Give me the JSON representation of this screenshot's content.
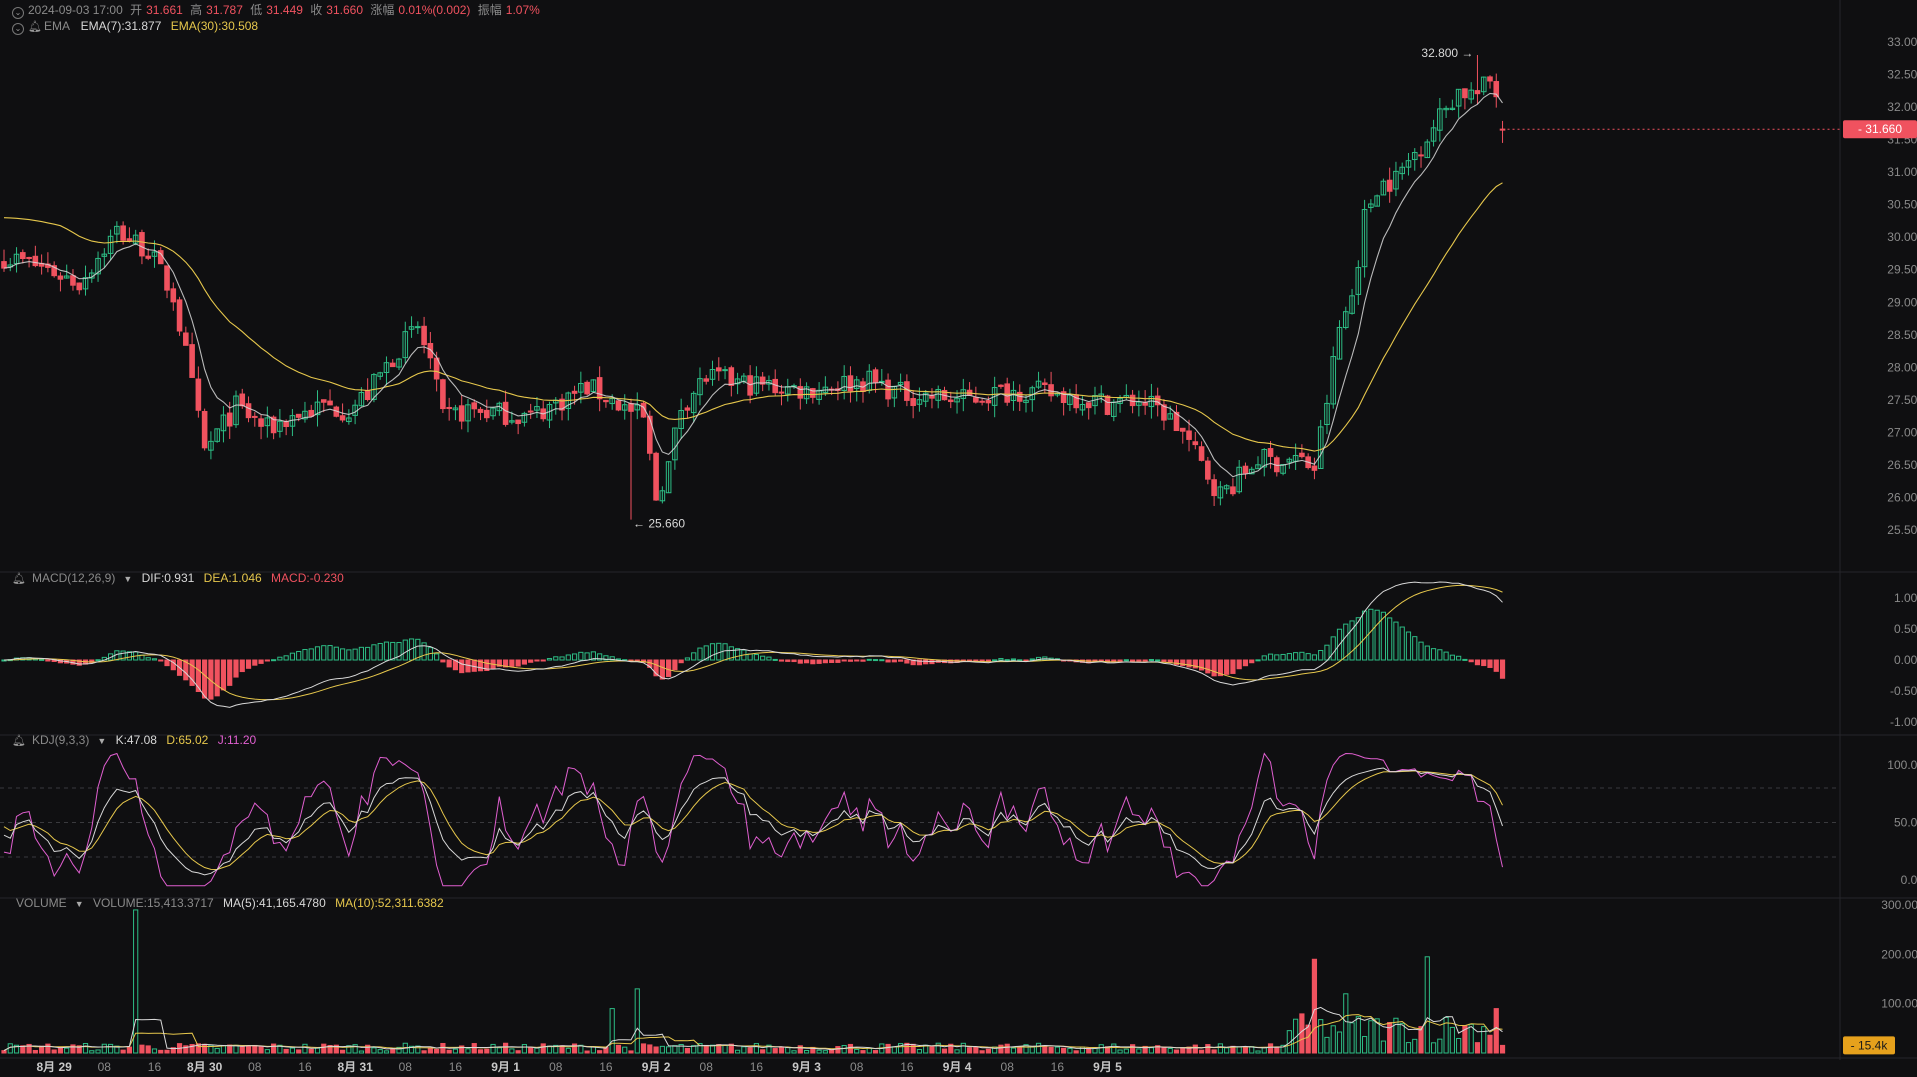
{
  "header": {
    "datetime": "2024-09-03 17:00",
    "open_label": "开",
    "open": "31.661",
    "high_label": "高",
    "high": "31.787",
    "low_label": "低",
    "low": "31.449",
    "close_label": "收",
    "close": "31.660",
    "change_label": "涨幅",
    "change": "0.01%(0.002)",
    "amp_label": "振幅",
    "amp": "1.07%"
  },
  "ema": {
    "label": "EMA",
    "ema7": "EMA(7):31.877",
    "ema30": "EMA(30):30.508"
  },
  "macd": {
    "label": "MACD(12,26,9)",
    "dif": "DIF:0.931",
    "dea": "DEA:1.046",
    "macd": "MACD:-0.230"
  },
  "kdj": {
    "label": "KDJ(9,3,3)",
    "k": "K:47.08",
    "d": "D:65.02",
    "j": "J:11.20"
  },
  "volume": {
    "label": "VOLUME",
    "vol": "VOLUME:15,413.3717",
    "ma5": "MA(5):41,165.4780",
    "ma10": "MA(10):52,311.6382"
  },
  "price_axis": [
    "33.000",
    "32.500",
    "32.000",
    "31.500",
    "31.000",
    "30.500",
    "30.000",
    "29.500",
    "29.000",
    "28.500",
    "28.000",
    "27.500",
    "27.000",
    "26.500",
    "26.000",
    "25.500"
  ],
  "macd_axis": [
    "1.000",
    "0.500",
    "0.000",
    "-0.500",
    "-1.000"
  ],
  "kdj_axis": [
    "100.00",
    "50.00",
    "0.00"
  ],
  "vol_axis": [
    "300.00k",
    "200.00k",
    "100.00k"
  ],
  "last_price": "31.660",
  "last_volume": "15.4k",
  "annotations": {
    "max": "32.800",
    "min": "25.660"
  },
  "time_axis": [
    {
      "t": "8月 29",
      "bold": true
    },
    {
      "t": "08"
    },
    {
      "t": "16"
    },
    {
      "t": "8月 30",
      "bold": true
    },
    {
      "t": "08"
    },
    {
      "t": "16"
    },
    {
      "t": "8月 31",
      "bold": true
    },
    {
      "t": "08"
    },
    {
      "t": "16"
    },
    {
      "t": "9月 1",
      "bold": true
    },
    {
      "t": "08"
    },
    {
      "t": "16"
    },
    {
      "t": "9月 2",
      "bold": true
    },
    {
      "t": "08"
    },
    {
      "t": "16"
    },
    {
      "t": "9月 3",
      "bold": true
    },
    {
      "t": "08"
    },
    {
      "t": "16"
    },
    {
      "t": "9月 4",
      "bold": true
    },
    {
      "t": "08"
    },
    {
      "t": "16"
    },
    {
      "t": "9月 5",
      "bold": true
    }
  ],
  "colors": {
    "up": "#2dbd85",
    "down": "#f0525f",
    "ema7": "#d8d8d8",
    "ema30": "#e6c74c",
    "j_line": "#e05fd0",
    "last_vol_tag": "#e6a11c"
  },
  "chart_data": {
    "type": "candlestick",
    "interval": "hourly",
    "start": "2024-08-28 16:00",
    "ylim": [
      25.5,
      33.0
    ],
    "close_path": [
      [
        0,
        29.7
      ],
      [
        6,
        29.55
      ],
      [
        12,
        29.3
      ],
      [
        18,
        30.1
      ],
      [
        23,
        29.8
      ],
      [
        27,
        29.1
      ],
      [
        29,
        28.2
      ],
      [
        32,
        26.7
      ],
      [
        37,
        27.4
      ],
      [
        42,
        27.05
      ],
      [
        46,
        27.25
      ],
      [
        51,
        27.4
      ],
      [
        55,
        27.35
      ],
      [
        58,
        27.6
      ],
      [
        63,
        28.3
      ],
      [
        66,
        28.6
      ],
      [
        68,
        28.1
      ],
      [
        70,
        27.2
      ],
      [
        74,
        27.35
      ],
      [
        79,
        27.3
      ],
      [
        84,
        27.25
      ],
      [
        89,
        27.5
      ],
      [
        93,
        27.7
      ],
      [
        97,
        27.5
      ],
      [
        102,
        27.2
      ],
      [
        104,
        26.0
      ],
      [
        106,
        26.5
      ],
      [
        108,
        27.4
      ],
      [
        112,
        27.85
      ],
      [
        118,
        27.75
      ],
      [
        123,
        27.7
      ],
      [
        128,
        27.65
      ],
      [
        133,
        27.75
      ],
      [
        138,
        27.8
      ],
      [
        143,
        27.6
      ],
      [
        148,
        27.55
      ],
      [
        153,
        27.5
      ],
      [
        158,
        27.6
      ],
      [
        162,
        27.65
      ],
      [
        166,
        27.6
      ],
      [
        171,
        27.55
      ],
      [
        176,
        27.45
      ],
      [
        181,
        27.5
      ],
      [
        185,
        27.3
      ],
      [
        188,
        27.0
      ],
      [
        191,
        26.5
      ],
      [
        194,
        26.05
      ],
      [
        197,
        26.3
      ],
      [
        200,
        26.6
      ],
      [
        203,
        26.55
      ],
      [
        206,
        26.6
      ],
      [
        209,
        26.45
      ],
      [
        211,
        27.5
      ],
      [
        213,
        28.6
      ],
      [
        215,
        29.1
      ],
      [
        217,
        30.3
      ],
      [
        219,
        30.8
      ],
      [
        222,
        30.9
      ],
      [
        225,
        31.3
      ],
      [
        228,
        31.7
      ],
      [
        230,
        32.0
      ],
      [
        232,
        32.25
      ],
      [
        235,
        32.2
      ],
      [
        237,
        32.4
      ],
      [
        239,
        32.1
      ],
      [
        240,
        31.66
      ]
    ],
    "ema7_last": 31.877,
    "ema30_last": 30.508,
    "max": 32.8,
    "min": 25.66,
    "macd": {
      "dif": 0.931,
      "dea": 1.046,
      "hist": -0.23,
      "ylim": [
        -1.0,
        1.0
      ]
    },
    "kdj": {
      "k": 47.08,
      "d": 65.02,
      "j": 11.2,
      "ylim": [
        0,
        100
      ]
    },
    "volume": {
      "last": 15413.3717,
      "ma5": 41165.478,
      "ma10": 52311.6382,
      "ylim": [
        0,
        300000
      ],
      "spikes": [
        [
          21,
          290000
        ],
        [
          97,
          90000
        ],
        [
          101,
          130000
        ],
        [
          209,
          190000
        ],
        [
          214,
          120000
        ],
        [
          227,
          195000
        ],
        [
          238,
          90000
        ]
      ]
    }
  }
}
